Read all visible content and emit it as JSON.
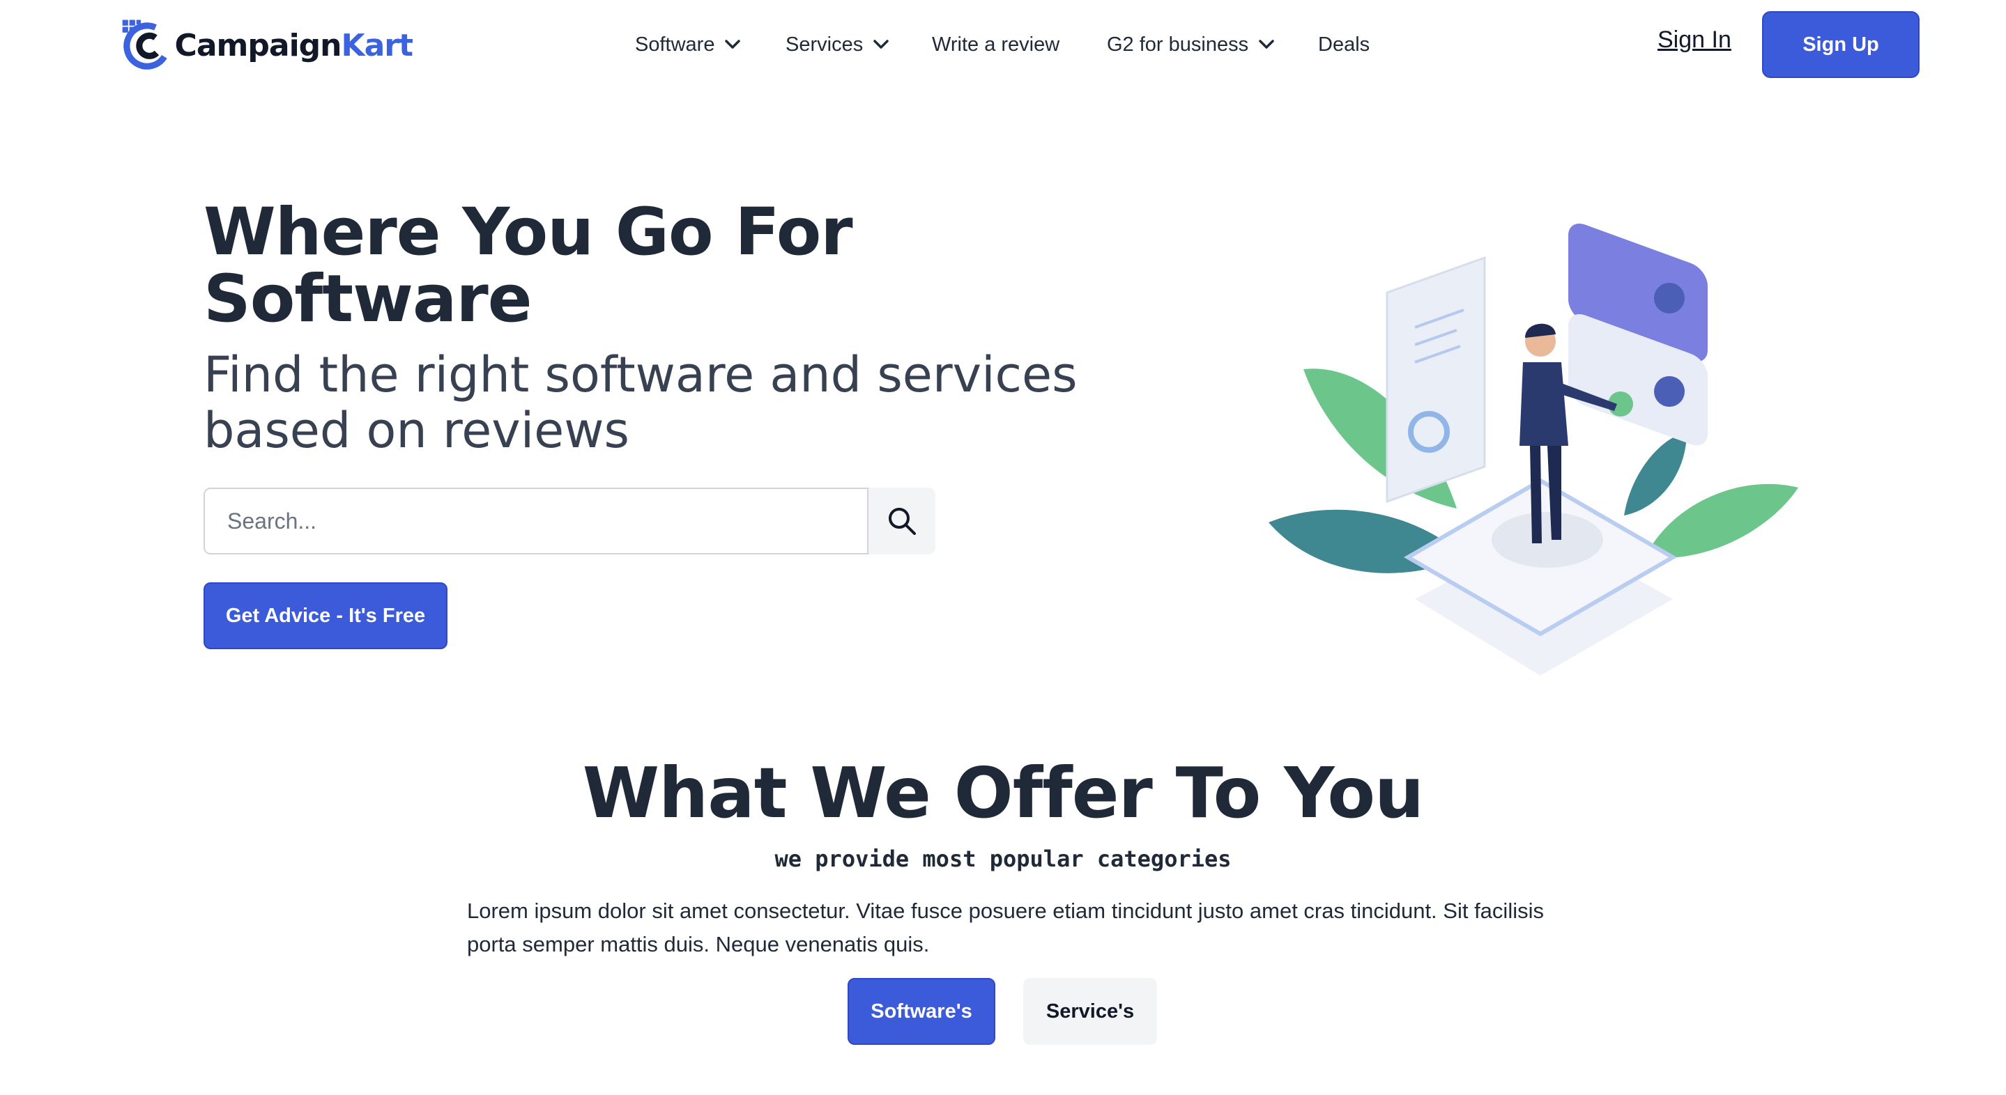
{
  "brand": {
    "name_part1": "Campaign",
    "name_part2": "Kart",
    "accent_color": "#3b5bdb"
  },
  "nav": {
    "items": [
      {
        "label": "Software",
        "dropdown": true
      },
      {
        "label": "Services",
        "dropdown": true
      },
      {
        "label": "Write a review",
        "dropdown": false
      },
      {
        "label": "G2 for business",
        "dropdown": true
      },
      {
        "label": "Deals",
        "dropdown": false
      }
    ],
    "sign_in": "Sign In",
    "sign_up": "Sign Up"
  },
  "hero": {
    "title": "Where You Go For Software",
    "subtitle": "Find the right software and services based on reviews",
    "search_placeholder": "Search...",
    "search_value": "",
    "search_icon": "search-icon",
    "cta": "Get Advice - It's Free"
  },
  "offer": {
    "title": "What We Offer To You",
    "subtitle": "we provide most popular categories",
    "description": "Lorem ipsum dolor sit amet consectetur. Vitae fusce posuere etiam tincidunt justo amet cras tincidunt. Sit facilisis porta semper mattis duis. Neque venenatis quis.",
    "tabs": [
      {
        "label": "Software's",
        "active": true
      },
      {
        "label": "Service's",
        "active": false
      }
    ]
  }
}
